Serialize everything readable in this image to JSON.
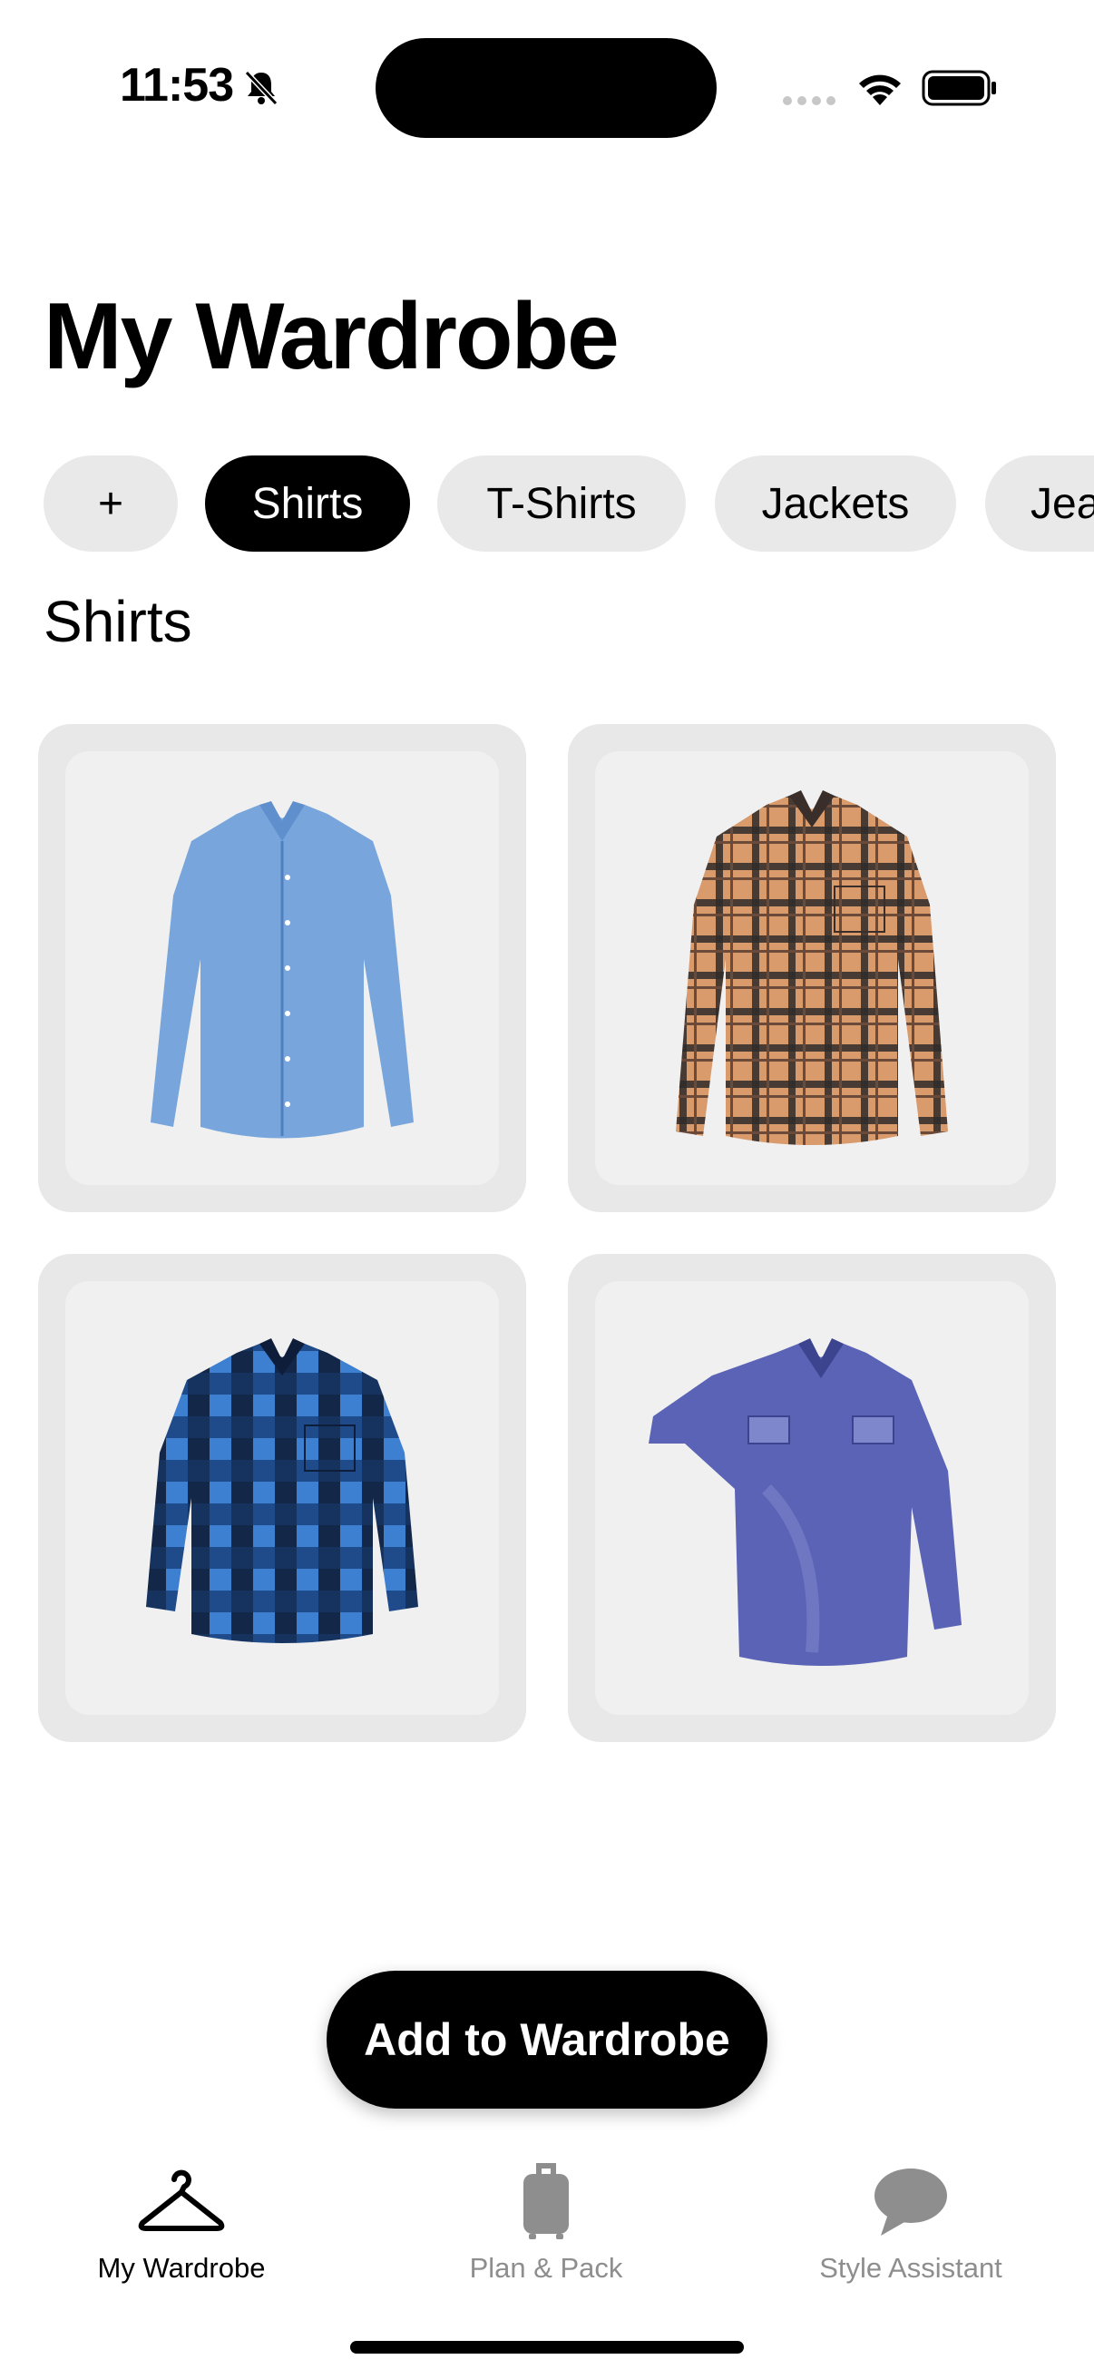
{
  "status_bar": {
    "time": "11:53"
  },
  "page": {
    "title": "My Wardrobe",
    "section_title": "Shirts"
  },
  "categories": {
    "add_label": "+",
    "items": [
      "Shirts",
      "T-Shirts",
      "Jackets",
      "Jea"
    ],
    "selected": "Shirts"
  },
  "items": [
    {
      "name": "blue-dress-shirt",
      "colors": [
        "#7aa7dc",
        "#5f8fcc"
      ]
    },
    {
      "name": "orange-plaid-shirt",
      "colors": [
        "#d99a6c",
        "#2f2a2a"
      ]
    },
    {
      "name": "blue-buffalo-check-shirt",
      "colors": [
        "#3d7fd1",
        "#0e1e3a"
      ]
    },
    {
      "name": "denim-shirt",
      "colors": [
        "#5a63b5",
        "#7e86cc"
      ]
    }
  ],
  "actions": {
    "add_to_wardrobe": "Add to Wardrobe"
  },
  "tab_bar": {
    "tabs": [
      {
        "label": "My Wardrobe",
        "icon": "hanger-icon",
        "active": true
      },
      {
        "label": "Plan & Pack",
        "icon": "luggage-icon",
        "active": false
      },
      {
        "label": "Style Assistant",
        "icon": "chat-bubble-icon",
        "active": false
      }
    ]
  },
  "colors": {
    "accent": "#000000",
    "chip_bg": "#e9e9ea",
    "card_bg": "#e8e8e8",
    "inactive_tab": "#8e8e8e"
  }
}
